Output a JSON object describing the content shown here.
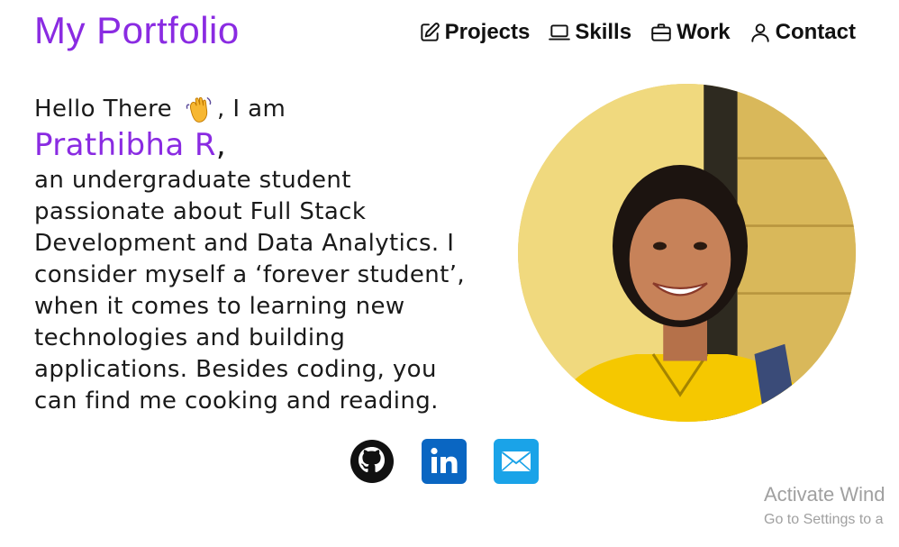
{
  "header": {
    "brand": "My Portfolio",
    "nav": [
      {
        "label": "Projects",
        "icon": "pencil-square-icon"
      },
      {
        "label": "Skills",
        "icon": "laptop-icon"
      },
      {
        "label": "Work",
        "icon": "briefcase-icon"
      },
      {
        "label": "Contact",
        "icon": "person-icon"
      }
    ]
  },
  "hero": {
    "greeting": "Hello There",
    "greeting_suffix": ", I am",
    "name": "Prathibha R",
    "name_suffix": ",",
    "bio_lines": [
      "an undergraduate student",
      "passionate about Full Stack",
      "Development and Data Analytics. I",
      "consider myself a ‘forever student’,",
      "when it comes to learning new",
      "technologies and building",
      "applications. Besides coding, you",
      "can find me cooking and reading."
    ],
    "wave_icon": "waving-hand-icon"
  },
  "socials": [
    {
      "name": "github",
      "icon": "github-icon"
    },
    {
      "name": "linkedin",
      "icon": "linkedin-icon"
    },
    {
      "name": "email",
      "icon": "mail-icon"
    }
  ],
  "watermark": {
    "title": "Activate Wind",
    "subtitle": "Go to Settings to a"
  },
  "colors": {
    "accent": "#8a2be2",
    "linkedin": "#0a66c2",
    "mail": "#1aa3e8"
  }
}
